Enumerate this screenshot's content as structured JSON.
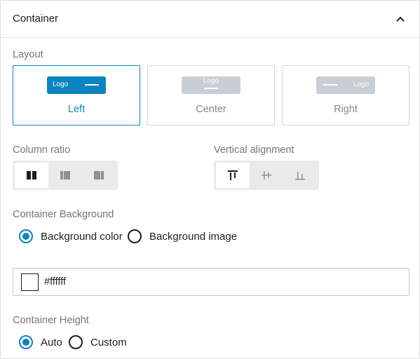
{
  "header": {
    "title": "Container",
    "collapse_icon": "chevron-up-icon"
  },
  "layout": {
    "label": "Layout",
    "options": [
      {
        "label": "Left",
        "preview_text": "Logo",
        "selected": true
      },
      {
        "label": "Center",
        "preview_text": "Logo",
        "selected": false
      },
      {
        "label": "Right",
        "preview_text": "Logo",
        "selected": false
      }
    ]
  },
  "column_ratio": {
    "label": "Column ratio",
    "options": [
      {
        "icon": "equal-columns-icon",
        "active": true
      },
      {
        "icon": "wide-left-columns-icon",
        "active": false
      },
      {
        "icon": "wide-right-columns-icon",
        "active": false
      }
    ]
  },
  "vertical_alignment": {
    "label": "Vertical alignment",
    "options": [
      {
        "icon": "align-top-icon",
        "active": true
      },
      {
        "icon": "align-middle-icon",
        "active": false
      },
      {
        "icon": "align-bottom-icon",
        "active": false
      }
    ]
  },
  "background": {
    "label": "Container Background",
    "options": [
      {
        "label": "Background color",
        "checked": true
      },
      {
        "label": "Background image",
        "checked": false
      }
    ],
    "color_value": "#ffffff"
  },
  "height": {
    "label": "Container Height",
    "options": [
      {
        "label": "Auto",
        "checked": true
      },
      {
        "label": "Custom",
        "checked": false
      }
    ]
  },
  "colors": {
    "accent": "#0a84c1",
    "inactive_preview": "#c9ced6",
    "segment_bg": "#eaeaea"
  }
}
